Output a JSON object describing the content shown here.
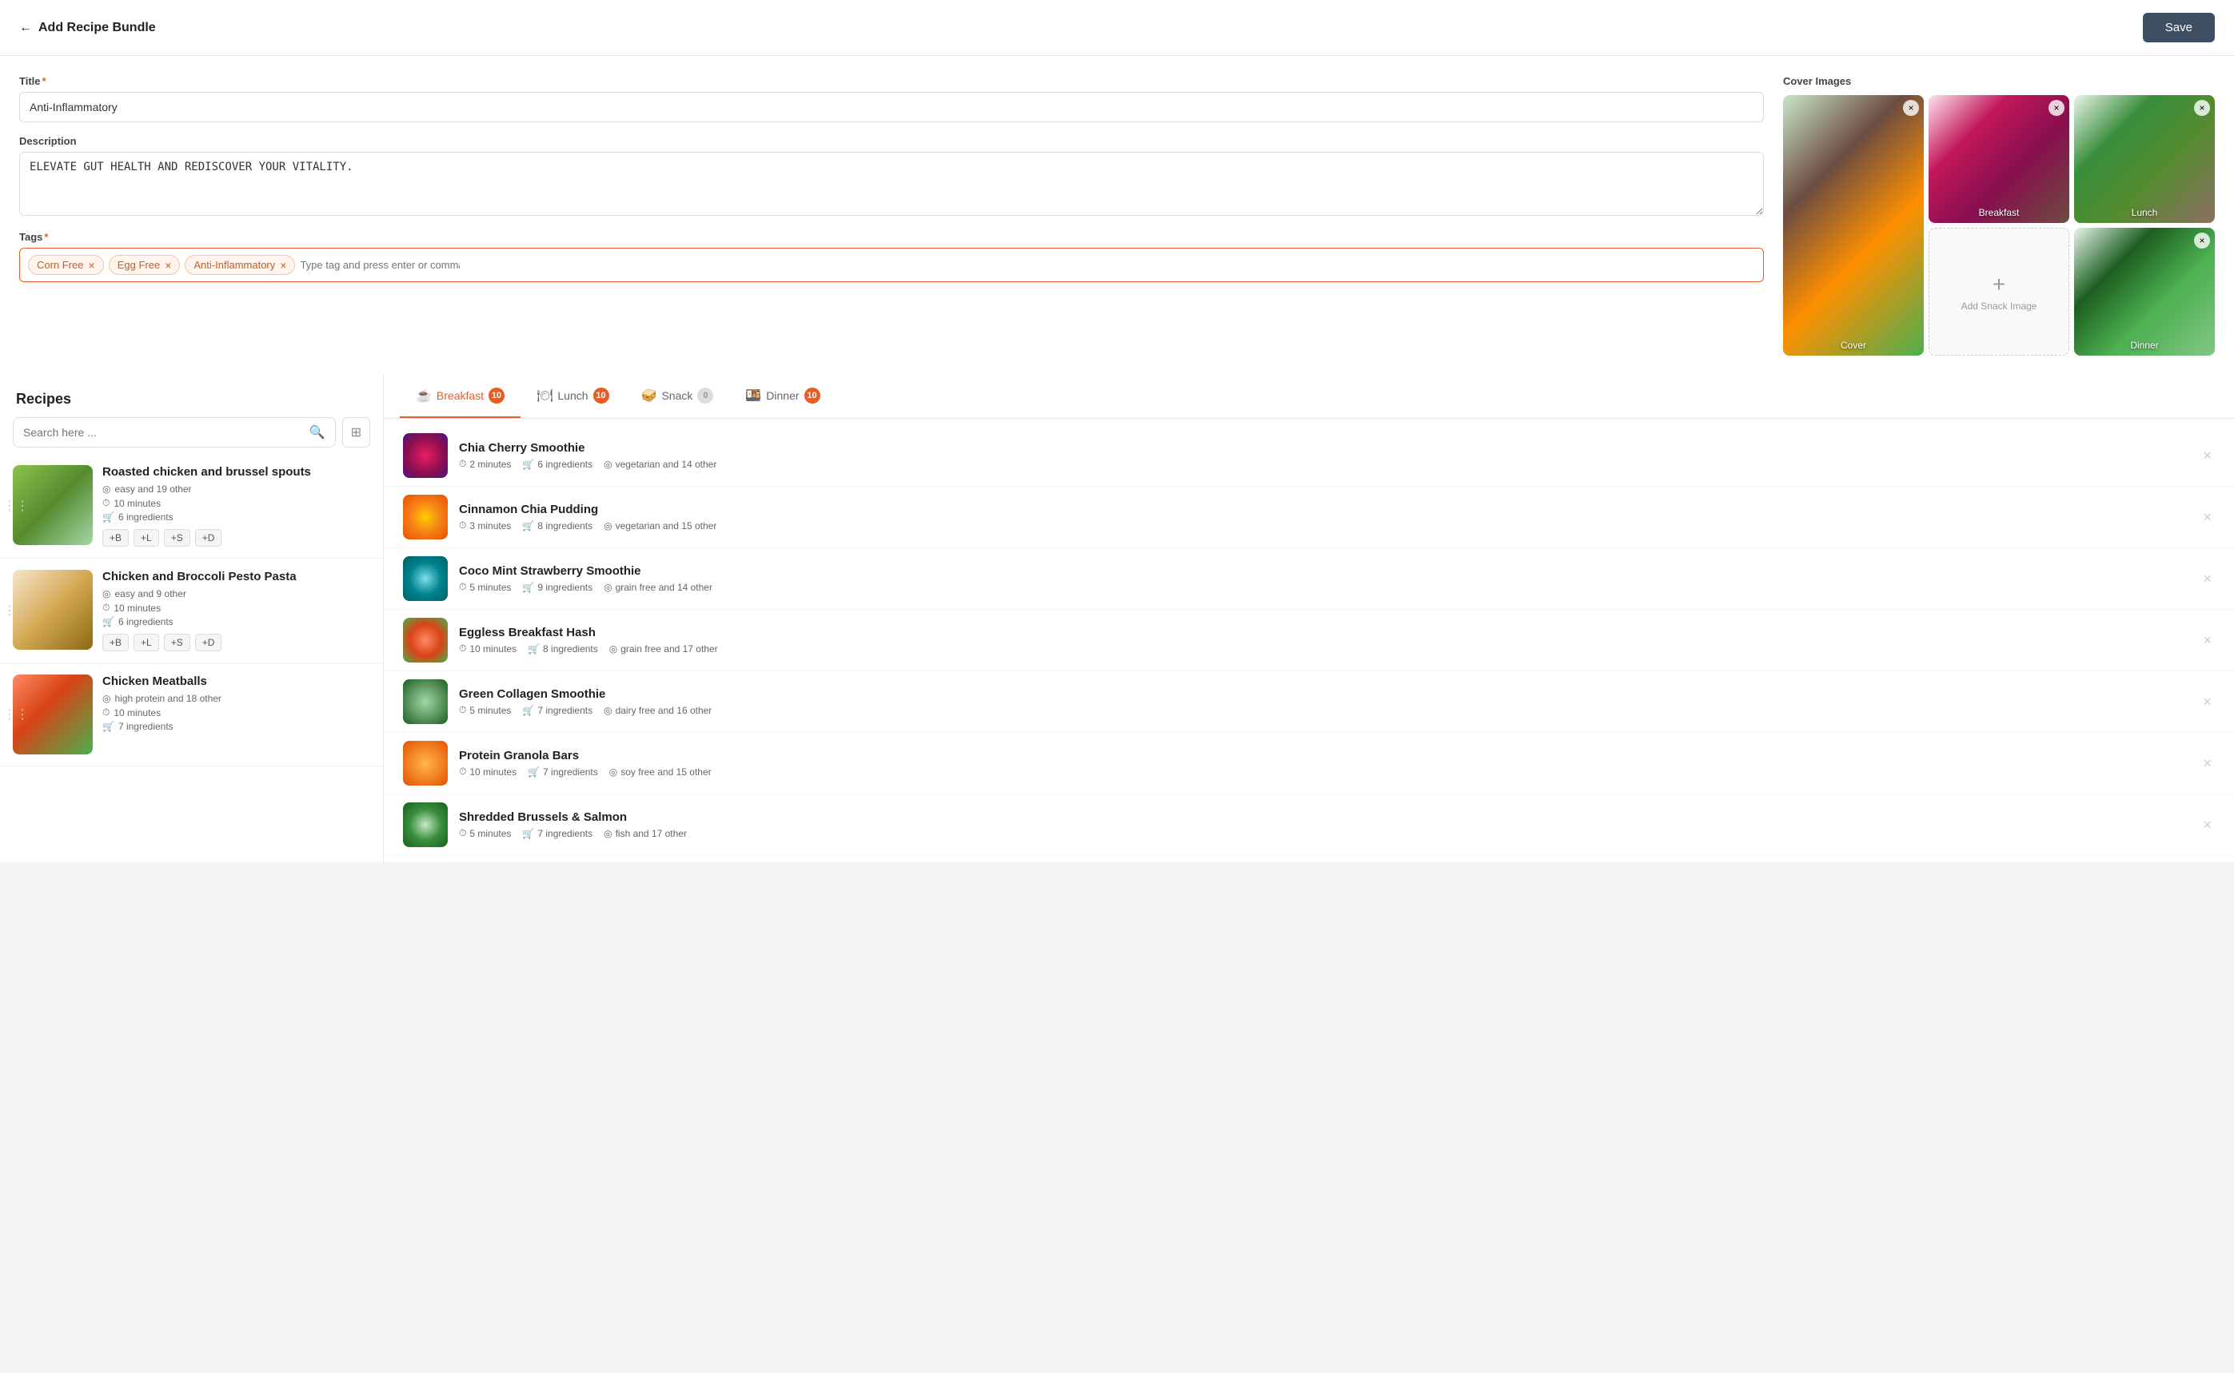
{
  "header": {
    "back_icon": "←",
    "title": "Add Recipe Bundle",
    "save_label": "Save"
  },
  "form": {
    "title_label": "Title",
    "title_value": "Anti-Inflammatory",
    "description_label": "Description",
    "description_value": "ELEVATE GUT HEALTH AND REDISCOVER YOUR VITALITY.",
    "tags_label": "Tags",
    "tags": [
      {
        "id": "corn-free",
        "label": "Corn Free"
      },
      {
        "id": "egg-free",
        "label": "Egg Free"
      },
      {
        "id": "anti-inflammatory",
        "label": "Anti-Inflammatory"
      }
    ],
    "tag_input_placeholder": "Type tag and press enter or comma"
  },
  "cover_images": {
    "section_label": "Cover Images",
    "images": [
      {
        "id": "cover",
        "label": "Cover",
        "type": "cover"
      },
      {
        "id": "breakfast",
        "label": "Breakfast",
        "type": "breakfast"
      },
      {
        "id": "lunch",
        "label": "Lunch",
        "type": "lunch"
      },
      {
        "id": "snack",
        "label": "Add Snack Image",
        "type": "snack-empty"
      },
      {
        "id": "dinner",
        "label": "Dinner",
        "type": "dinner"
      }
    ]
  },
  "recipes_panel": {
    "title": "Recipes",
    "search_placeholder": "Search here ...",
    "filter_icon": "⊞",
    "items": [
      {
        "id": "r1",
        "name": "Roasted chicken and brussel spouts",
        "tags_text": "easy and 19 other",
        "time": "10 minutes",
        "ingredients": "6 ingredients",
        "meal_tags": [
          "+B",
          "+L",
          "+S",
          "+D"
        ],
        "img_class": "food-img-1"
      },
      {
        "id": "r2",
        "name": "Chicken and Broccoli Pesto Pasta",
        "tags_text": "easy and 9 other",
        "time": "10 minutes",
        "ingredients": "6 ingredients",
        "meal_tags": [
          "+B",
          "+L",
          "+S",
          "+D"
        ],
        "img_class": "food-img-2"
      },
      {
        "id": "r3",
        "name": "Chicken Meatballs",
        "tags_text": "high protein and 18 other",
        "time": "10 minutes",
        "ingredients": "7 ingredients",
        "meal_tags": [],
        "img_class": "food-img-3"
      }
    ]
  },
  "bundle_panel": {
    "tabs": [
      {
        "id": "breakfast",
        "label": "Breakfast",
        "count": 10,
        "icon": "☕",
        "active": true
      },
      {
        "id": "lunch",
        "label": "Lunch",
        "count": 10,
        "icon": "🍽",
        "active": false
      },
      {
        "id": "snack",
        "label": "Snack",
        "count": 0,
        "icon": "🥪",
        "active": false
      },
      {
        "id": "dinner",
        "label": "Dinner",
        "count": 10,
        "icon": "🍱",
        "active": false
      }
    ],
    "breakfast_items": [
      {
        "id": "bi1",
        "name": "Chia Cherry Smoothie",
        "time": "2 minutes",
        "ingredients": "6 ingredients",
        "tags": "vegetarian and 14 other",
        "img_class": "food-img-bundle-1"
      },
      {
        "id": "bi2",
        "name": "Cinnamon Chia Pudding",
        "time": "3 minutes",
        "ingredients": "8 ingredients",
        "tags": "vegetarian and 15 other",
        "img_class": "food-img-bundle-2"
      },
      {
        "id": "bi3",
        "name": "Coco Mint Strawberry Smoothie",
        "time": "5 minutes",
        "ingredients": "9 ingredients",
        "tags": "grain free and 14 other",
        "img_class": "food-img-bundle-3"
      },
      {
        "id": "bi4",
        "name": "Eggless Breakfast Hash",
        "time": "10 minutes",
        "ingredients": "8 ingredients",
        "tags": "grain free and 17 other",
        "img_class": "food-img-bundle-4"
      },
      {
        "id": "bi5",
        "name": "Green Collagen Smoothie",
        "time": "5 minutes",
        "ingredients": "7 ingredients",
        "tags": "dairy free and 16 other",
        "img_class": "food-img-bundle-5"
      },
      {
        "id": "bi6",
        "name": "Protein Granola Bars",
        "time": "10 minutes",
        "ingredients": "7 ingredients",
        "tags": "soy free and 15 other",
        "img_class": "food-img-bundle-6"
      },
      {
        "id": "bi7",
        "name": "Shredded Brussels & Salmon",
        "time": "5 minutes",
        "ingredients": "7 ingredients",
        "tags": "fish and 17 other",
        "img_class": "food-img-bundle-7"
      }
    ]
  },
  "icons": {
    "clock": "⏱",
    "cart": "🛒",
    "tag": "🏷",
    "search": "🔍",
    "close": "×",
    "back": "←",
    "plus": "+"
  },
  "colors": {
    "accent": "#e85d26",
    "dark": "#3d4f60",
    "tag_bg": "#fff3ee",
    "tag_border": "#f0c5a8",
    "tag_text": "#c0622a"
  }
}
